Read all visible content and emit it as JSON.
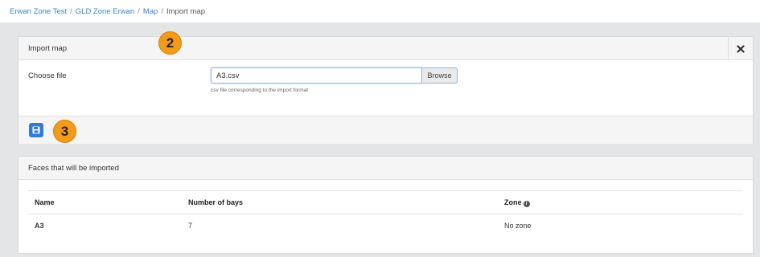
{
  "breadcrumb": {
    "items": [
      "Erwan Zone Test",
      "GLD Zone Erwan",
      "Map"
    ],
    "current": "Import map",
    "separator": "/"
  },
  "import_panel": {
    "title": "Import map",
    "choose_file_label": "Choose file",
    "file_value": "A3.csv",
    "browse_label": "Browse",
    "help_text": "csv file corresponding to the import format",
    "close_icon": "close-icon",
    "save_icon": "floppy-disk-icon"
  },
  "annotations": {
    "step2": "2",
    "step3": "3",
    "badge_color": "#f29a1a"
  },
  "faces_panel": {
    "title": "Faces that will be imported",
    "columns": [
      "Name",
      "Number of bays",
      "Zone"
    ],
    "zone_info_icon": "info-icon",
    "rows": [
      {
        "name": "A3",
        "bays": "7",
        "zone": "No zone"
      }
    ]
  },
  "colors": {
    "link": "#3a87c8",
    "primary_button": "#2f7bd8",
    "background": "#e4e5e7"
  }
}
